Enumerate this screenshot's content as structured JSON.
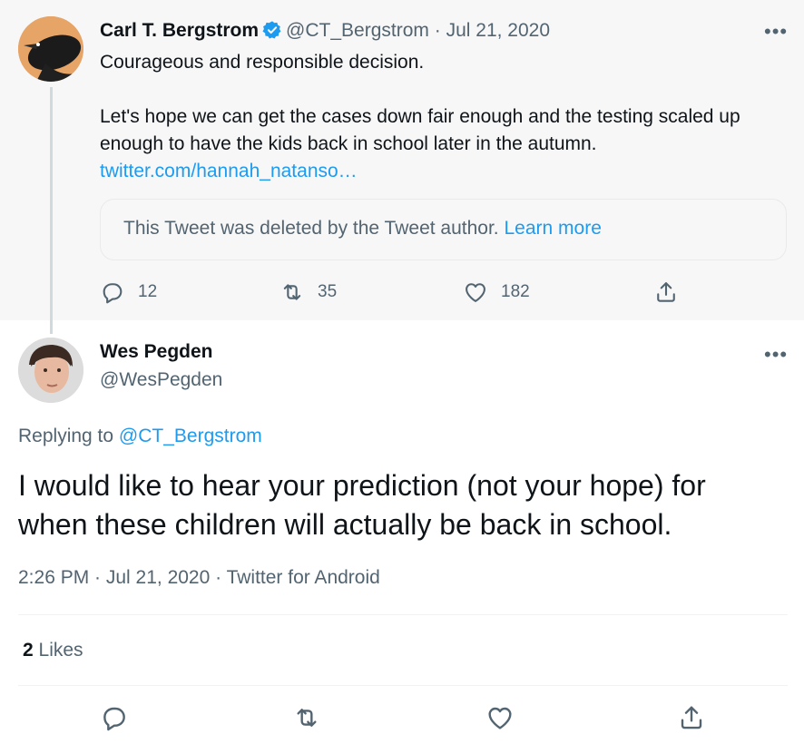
{
  "parent_tweet": {
    "author_name": "Carl T. Bergstrom",
    "handle": "@CT_Bergstrom",
    "separator": "·",
    "date": "Jul 21, 2020",
    "body_line1": "Courageous and responsible decision.",
    "body_line2": "Let's hope we can get the cases down fair enough and the testing scaled up",
    "body_line3": "enough to have the kids back in school later in the autumn.",
    "link": "twitter.com/hannah_natanso…",
    "deleted_notice": "This Tweet was deleted by the Tweet author.",
    "learn_more": "Learn more",
    "reply_count": "12",
    "retweet_count": "35",
    "like_count": "182",
    "more_label": "•••"
  },
  "reply_tweet": {
    "author_name": "Wes Pegden",
    "handle": "@WesPegden",
    "replying_prefix": "Replying to",
    "replying_to": "@CT_Bergstrom",
    "text_line1": "I would like to hear your prediction (not your hope) for",
    "text_line2": "when these children will actually be back in school.",
    "timestamp": "2:26 PM · Jul 21, 2020 · Twitter for Android",
    "likes_count": "2",
    "likes_label": "Likes",
    "more_label": "•••"
  },
  "icons": {
    "reply": "reply-icon",
    "retweet": "retweet-icon",
    "like": "heart-icon",
    "share": "share-icon",
    "verified": "verified-badge-icon"
  },
  "colors": {
    "accent": "#1d9bf0",
    "secondary_text": "#536471",
    "parent_background": "#f7f7f7"
  }
}
